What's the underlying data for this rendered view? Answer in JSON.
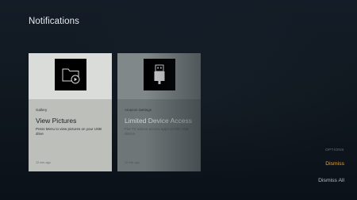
{
  "header": {
    "title": "Notifications"
  },
  "notifications": [
    {
      "source": "Gallery",
      "title": "View Pictures",
      "description": "Press Menu to view pictures on your USB drive",
      "time": "12 min ago",
      "icon": "folder-play-icon"
    },
    {
      "source": "Amazon Settings",
      "title": "Limited Device Access",
      "description": "Fire TV cannot access apps on this USB device.",
      "time": "12 min ago",
      "icon": "usb-plug-icon"
    }
  ],
  "options_menu": {
    "heading": "OPTIONS",
    "dismiss_label": "Dismiss",
    "dismiss_all_label": "Dismiss All"
  },
  "colors": {
    "accent": "#f0a028",
    "background": "#101820"
  }
}
